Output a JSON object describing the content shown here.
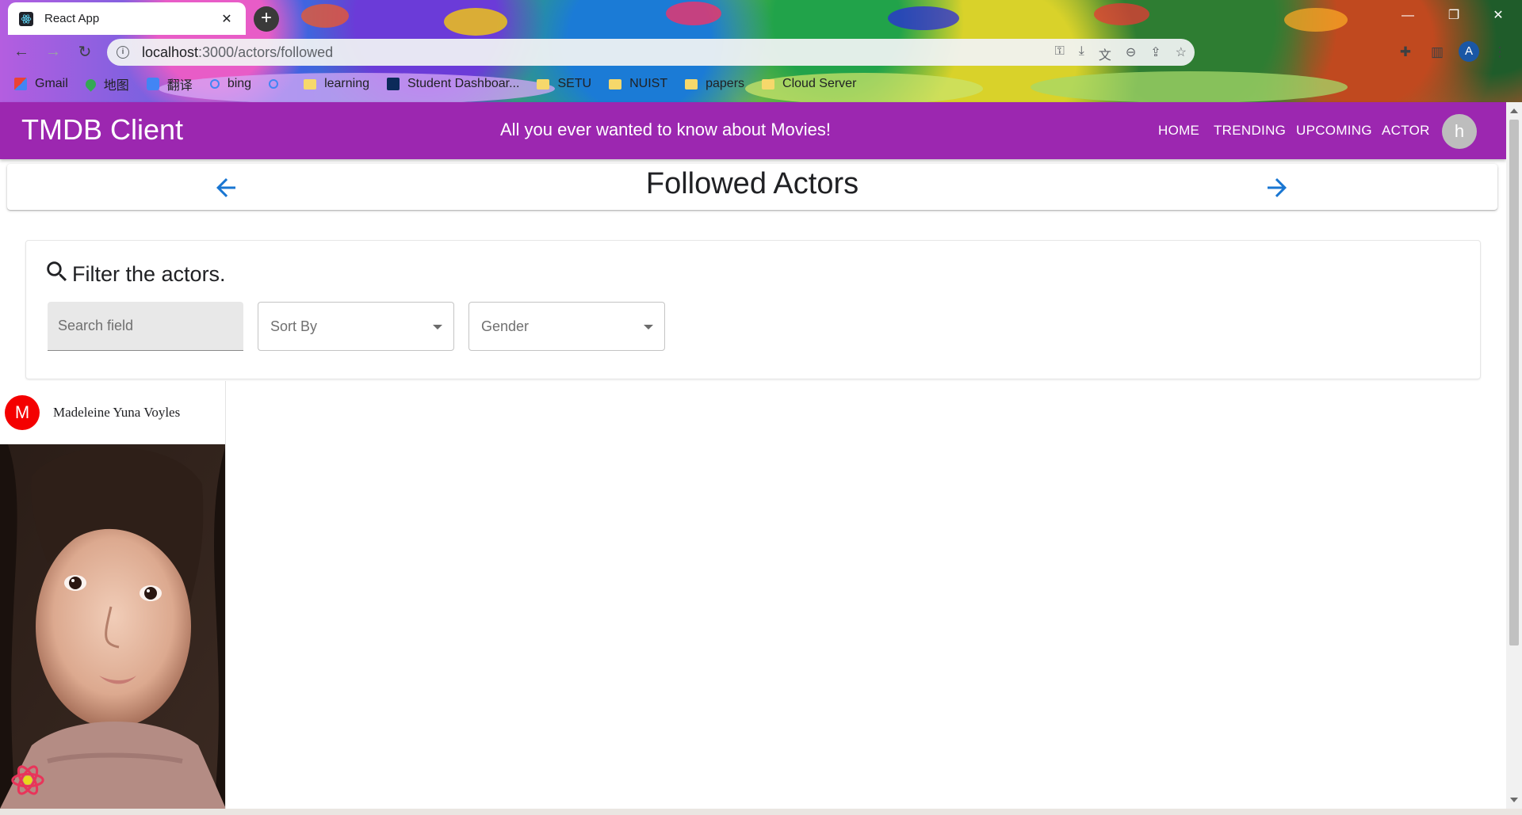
{
  "browser": {
    "tab_title": "React App",
    "tab_close": "✕",
    "new_tab": "+",
    "url_host": "localhost",
    "url_path": ":3000/actors/followed",
    "profile_initial": "A",
    "bookmarks": [
      {
        "label": "Gmail",
        "icon": "gmail-icon"
      },
      {
        "label": "地图",
        "icon": "maps-icon"
      },
      {
        "label": "翻译",
        "icon": "translate-icon"
      },
      {
        "label": "bing",
        "icon": "search-icon"
      },
      {
        "label": "",
        "icon": "search-icon"
      },
      {
        "label": "learning",
        "icon": "folder-icon"
      },
      {
        "label": "Student Dashboar...",
        "icon": "dashboard-icon"
      },
      {
        "label": "SETU",
        "icon": "folder-icon"
      },
      {
        "label": "NUIST",
        "icon": "folder-icon"
      },
      {
        "label": "papers",
        "icon": "folder-icon"
      },
      {
        "label": "Cloud Server",
        "icon": "folder-icon"
      }
    ]
  },
  "app": {
    "brand": "TMDB Client",
    "tagline": "All you ever wanted to know about Movies!",
    "nav": [
      "HOME",
      "TRENDING",
      "UPCOMING",
      "ACTOR"
    ],
    "user_initial": "h"
  },
  "page": {
    "title": "Followed Actors"
  },
  "filter": {
    "title": "Filter the actors.",
    "search_placeholder": "Search field",
    "sort_label": "Sort By",
    "gender_label": "Gender"
  },
  "actors": [
    {
      "initial": "M",
      "name": "Madeleine Yuna Voyles"
    }
  ],
  "colors": {
    "appbar": "#9c27b0",
    "arrow": "#1976d2",
    "actor_avatar": "#f40000"
  }
}
